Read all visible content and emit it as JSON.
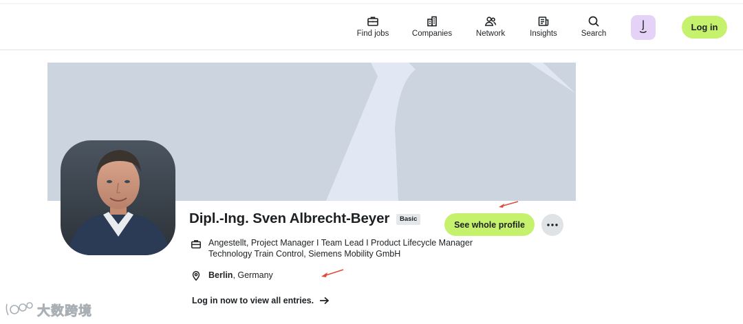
{
  "nav": {
    "items": [
      {
        "label": "Find jobs",
        "icon": "briefcase-icon"
      },
      {
        "label": "Companies",
        "icon": "building-icon"
      },
      {
        "label": "Network",
        "icon": "people-icon"
      },
      {
        "label": "Insights",
        "icon": "newspaper-icon"
      },
      {
        "label": "Search",
        "icon": "search-icon"
      }
    ],
    "login_label": "Log in"
  },
  "profile": {
    "name": "Dipl.-Ing. Sven Albrecht-Beyer",
    "badge": "Basic",
    "see_profile_label": "See whole profile",
    "job_line1": "Angestellt, Project Manager I Team Lead I Product Lifecycle Manager",
    "job_line2": "Technology Train Control, Siemens Mobility GmbH",
    "city": "Berlin",
    "country": ", Germany",
    "login_prompt": "Log in now to view all entries."
  },
  "watermark": {
    "text": "大数跨境"
  },
  "colors": {
    "accent": "#c6f16d",
    "cover": "#ccd4df",
    "cover_light": "#e1e8f4",
    "avatar_bg": "#e4d3f7",
    "annotation_arrow": "#e0483e"
  }
}
